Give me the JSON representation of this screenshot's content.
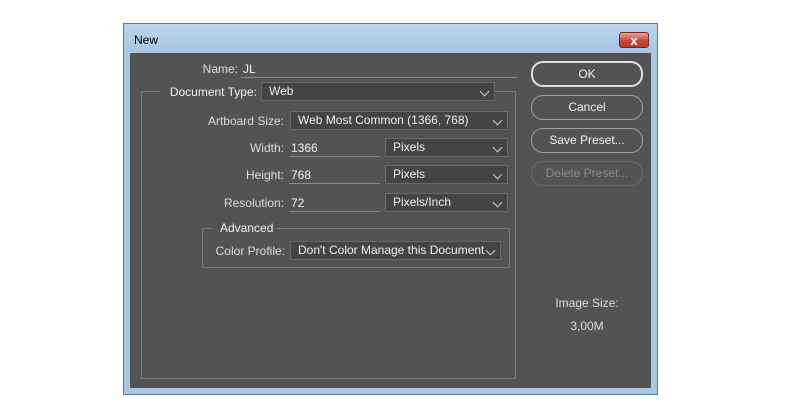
{
  "window": {
    "title": "New",
    "close_label": "x"
  },
  "name": {
    "label": "Name:",
    "value": "JL"
  },
  "document_type": {
    "label": "Document Type:",
    "value": "Web"
  },
  "artboard_size": {
    "label": "Artboard Size:",
    "value": "Web Most Common (1366, 768)"
  },
  "width": {
    "label": "Width:",
    "value": "1366",
    "unit": "Pixels"
  },
  "height": {
    "label": "Height:",
    "value": "768",
    "unit": "Pixels"
  },
  "resolution": {
    "label": "Resolution:",
    "value": "72",
    "unit": "Pixels/Inch"
  },
  "advanced": {
    "legend": "Advanced",
    "color_profile_label": "Color Profile:",
    "color_profile_value": "Don't Color Manage this Document"
  },
  "buttons": {
    "ok": "OK",
    "cancel": "Cancel",
    "save_preset": "Save Preset...",
    "delete_preset": "Delete Preset..."
  },
  "image_size": {
    "label": "Image Size:",
    "value": "3,00M"
  },
  "colors": {
    "panel_bg": "#535353",
    "titlebar": "#a9c6e2",
    "close_button": "#c9473a"
  }
}
